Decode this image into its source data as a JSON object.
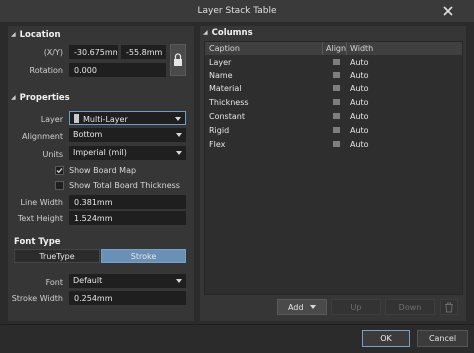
{
  "window": {
    "title": "Layer Stack Table"
  },
  "location": {
    "section": "Location",
    "xy_label": "(X/Y)",
    "x_value": "-30.675mm",
    "y_value": "-55.8mm",
    "rotation_label": "Rotation",
    "rotation_value": "0.000"
  },
  "properties": {
    "section": "Properties",
    "layer_label": "Layer",
    "layer_value": "Multi-Layer",
    "layer_swatch_color": "#c9c9c9",
    "alignment_label": "Alignment",
    "alignment_value": "Bottom",
    "units_label": "Units",
    "units_value": "Imperial (mil)",
    "show_board_map_label": "Show Board Map",
    "show_board_map_checked": true,
    "show_total_thickness_label": "Show Total Board Thickness",
    "show_total_thickness_checked": false,
    "line_width_label": "Line Width",
    "line_width_value": "0.381mm",
    "text_height_label": "Text Height",
    "text_height_value": "1.524mm"
  },
  "font_type": {
    "section": "Font Type",
    "truetype_label": "TrueType",
    "stroke_label": "Stroke",
    "selected": "Stroke",
    "font_label": "Font",
    "font_value": "Default",
    "stroke_width_label": "Stroke Width",
    "stroke_width_value": "0.254mm"
  },
  "columns": {
    "section": "Columns",
    "headers": {
      "caption": "Caption",
      "align": "Align",
      "width": "Width"
    },
    "rows": [
      {
        "caption": "Layer",
        "width": "Auto",
        "align_icon": "align-left-icon"
      },
      {
        "caption": "Name",
        "width": "Auto",
        "align_icon": "align-left-icon"
      },
      {
        "caption": "Material",
        "width": "Auto",
        "align_icon": "align-left-icon"
      },
      {
        "caption": "Thickness",
        "width": "Auto",
        "align_icon": "align-left-icon"
      },
      {
        "caption": "Constant",
        "width": "Auto",
        "align_icon": "align-left-icon"
      },
      {
        "caption": "Rigid",
        "width": "Auto",
        "align_icon": "align-left-icon"
      },
      {
        "caption": "Flex",
        "width": "Auto",
        "align_icon": "align-left-icon"
      }
    ],
    "add_label": "Add",
    "up_label": "Up",
    "down_label": "Down"
  },
  "footer": {
    "ok_label": "OK",
    "cancel_label": "Cancel"
  },
  "colors": {
    "accent": "#6a90b8",
    "background": "#2b2b2b",
    "panel": "#363636",
    "field": "#1f1f1f"
  }
}
